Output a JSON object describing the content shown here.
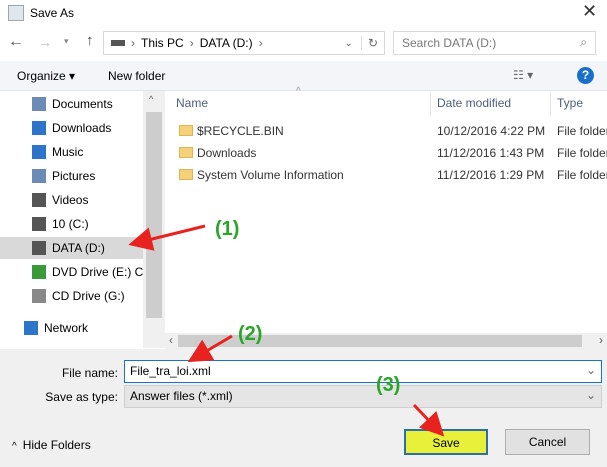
{
  "window": {
    "title": "Save As",
    "close": "✕"
  },
  "address": {
    "path": [
      "This PC",
      "DATA (D:)"
    ],
    "search_placeholder": "Search DATA (D:)"
  },
  "toolbar": {
    "organize": "Organize ▾",
    "new_folder": "New folder",
    "view": "☷ ▾",
    "help": "?"
  },
  "nav": [
    {
      "label": "Documents",
      "icon": "documents-icon",
      "color": "#6b8bb5"
    },
    {
      "label": "Downloads",
      "icon": "downloads-icon",
      "color": "#2e75c9"
    },
    {
      "label": "Music",
      "icon": "music-icon",
      "color": "#2e75c9"
    },
    {
      "label": "Pictures",
      "icon": "pictures-icon",
      "color": "#6b8bb5"
    },
    {
      "label": "Videos",
      "icon": "videos-icon",
      "color": "#555"
    },
    {
      "label": "10 (C:)",
      "icon": "drive-icon",
      "color": "#555"
    },
    {
      "label": "DATA (D:)",
      "icon": "drive-icon",
      "color": "#555",
      "selected": true
    },
    {
      "label": "DVD Drive (E:) CI",
      "icon": "dvd-icon",
      "color": "#3a9a3a"
    },
    {
      "label": "CD Drive (G:)",
      "icon": "cd-icon",
      "color": "#888"
    },
    {
      "label": "Network",
      "icon": "network-icon",
      "color": "#2e75c9"
    }
  ],
  "columns": {
    "name": "Name",
    "date": "Date modified",
    "type": "Type"
  },
  "files": [
    {
      "name": "$RECYCLE.BIN",
      "date": "10/12/2016 4:22 PM",
      "type": "File folder"
    },
    {
      "name": "Downloads",
      "date": "11/12/2016 1:43 PM",
      "type": "File folder"
    },
    {
      "name": "System Volume Information",
      "date": "11/12/2016 1:29 PM",
      "type": "File folder"
    }
  ],
  "form": {
    "file_name_label": "File name:",
    "file_name": "File_tra_loi.xml",
    "type_label": "Save as type:",
    "type_value": "Answer files (*.xml)"
  },
  "buttons": {
    "hide_folders": "Hide Folders",
    "save": "Save",
    "cancel": "Cancel"
  },
  "annotations": {
    "a1": "(1)",
    "a2": "(2)",
    "a3": "(3)",
    "arrow_color": "#e8231f",
    "label_color": "#2aa52a",
    "highlight_color": "#e8f03a"
  }
}
